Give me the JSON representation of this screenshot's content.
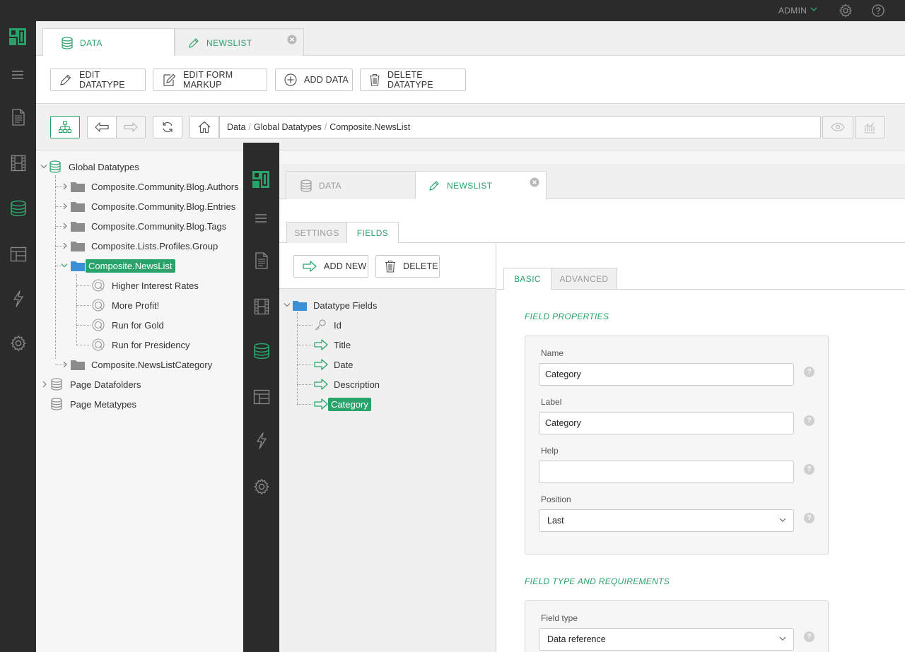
{
  "header": {
    "user": "ADMIN"
  },
  "back": {
    "tabs": [
      {
        "label": "DATA"
      },
      {
        "label": "NEWSLIST"
      }
    ],
    "toolbar": {
      "edit_datatype": "EDIT DATATYPE",
      "edit_form_markup": "EDIT FORM MARKUP",
      "add_data": "ADD DATA",
      "delete_datatype": "DELETE DATATYPE"
    },
    "breadcrumb": {
      "parts": [
        "Data",
        "Global Datatypes",
        "Composite.NewsList"
      ],
      "sep": "/"
    },
    "tree": {
      "root": "Global Datatypes",
      "items": [
        "Composite.Community.Blog.Authors",
        "Composite.Community.Blog.Entries",
        "Composite.Community.Blog.Tags",
        "Composite.Lists.Profiles.Group",
        "Composite.NewsList",
        "Composite.NewsListCategory"
      ],
      "newslist_children": [
        "Higher Interest Rates",
        "More Profit!",
        "Run for Gold",
        "Run for Presidency"
      ],
      "page_datafolders": "Page Datafolders",
      "page_metatypes": "Page Metatypes"
    }
  },
  "front": {
    "tabs": [
      {
        "label": "DATA"
      },
      {
        "label": "NEWSLIST"
      }
    ],
    "subtabs": [
      "SETTINGS",
      "FIELDS"
    ],
    "toolbar": {
      "add_new": "ADD NEW",
      "delete": "DELETE"
    },
    "fields_tree": {
      "root": "Datatype Fields",
      "items": [
        "Id",
        "Title",
        "Date",
        "Description",
        "Category"
      ]
    },
    "prop_tabs": [
      "BASIC",
      "ADVANCED"
    ],
    "field_properties": {
      "title": "FIELD PROPERTIES",
      "name_label": "Name",
      "name_value": "Category",
      "label_label": "Label",
      "label_value": "Category",
      "help_label": "Help",
      "help_value": "",
      "position_label": "Position",
      "position_value": "Last"
    },
    "field_type": {
      "title": "FIELD TYPE AND REQUIREMENTS",
      "type_label": "Field type",
      "type_value": "Data reference"
    },
    "help_glyph": "?"
  }
}
